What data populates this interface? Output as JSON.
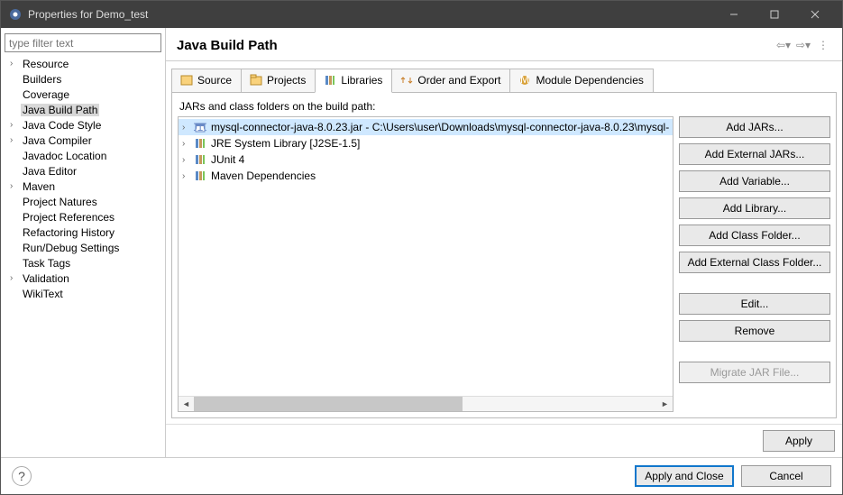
{
  "window": {
    "title": "Properties for Demo_test"
  },
  "sidebar": {
    "filter_placeholder": "type filter text",
    "items": [
      {
        "label": "Resource",
        "expandable": true
      },
      {
        "label": "Builders",
        "expandable": false
      },
      {
        "label": "Coverage",
        "expandable": false
      },
      {
        "label": "Java Build Path",
        "expandable": false,
        "selected": true
      },
      {
        "label": "Java Code Style",
        "expandable": true
      },
      {
        "label": "Java Compiler",
        "expandable": true
      },
      {
        "label": "Javadoc Location",
        "expandable": false
      },
      {
        "label": "Java Editor",
        "expandable": false
      },
      {
        "label": "Maven",
        "expandable": true
      },
      {
        "label": "Project Natures",
        "expandable": false
      },
      {
        "label": "Project References",
        "expandable": false
      },
      {
        "label": "Refactoring History",
        "expandable": false
      },
      {
        "label": "Run/Debug Settings",
        "expandable": false
      },
      {
        "label": "Task Tags",
        "expandable": false
      },
      {
        "label": "Validation",
        "expandable": true
      },
      {
        "label": "WikiText",
        "expandable": false
      }
    ]
  },
  "page": {
    "title": "Java Build Path",
    "tabs": [
      {
        "label": "Source"
      },
      {
        "label": "Projects"
      },
      {
        "label": "Libraries",
        "active": true
      },
      {
        "label": "Order and Export"
      },
      {
        "label": "Module Dependencies"
      }
    ],
    "desc": "JARs and class folders on the build path:",
    "entries": [
      {
        "label": "mysql-connector-java-8.0.23.jar - C:\\Users\\user\\Downloads\\mysql-connector-java-8.0.23\\mysql-",
        "icon": "jar",
        "selected": true
      },
      {
        "label": "JRE System Library [J2SE-1.5]",
        "icon": "library"
      },
      {
        "label": "JUnit 4",
        "icon": "library"
      },
      {
        "label": "Maven Dependencies",
        "icon": "library"
      }
    ],
    "buttons": {
      "add_jars": "Add JARs...",
      "add_ext_jars": "Add External JARs...",
      "add_var": "Add Variable...",
      "add_lib": "Add Library...",
      "add_class": "Add Class Folder...",
      "add_ext_class": "Add External Class Folder...",
      "edit": "Edit...",
      "remove": "Remove",
      "migrate": "Migrate JAR File..."
    },
    "apply": "Apply"
  },
  "footer": {
    "apply_close": "Apply and Close",
    "cancel": "Cancel"
  }
}
